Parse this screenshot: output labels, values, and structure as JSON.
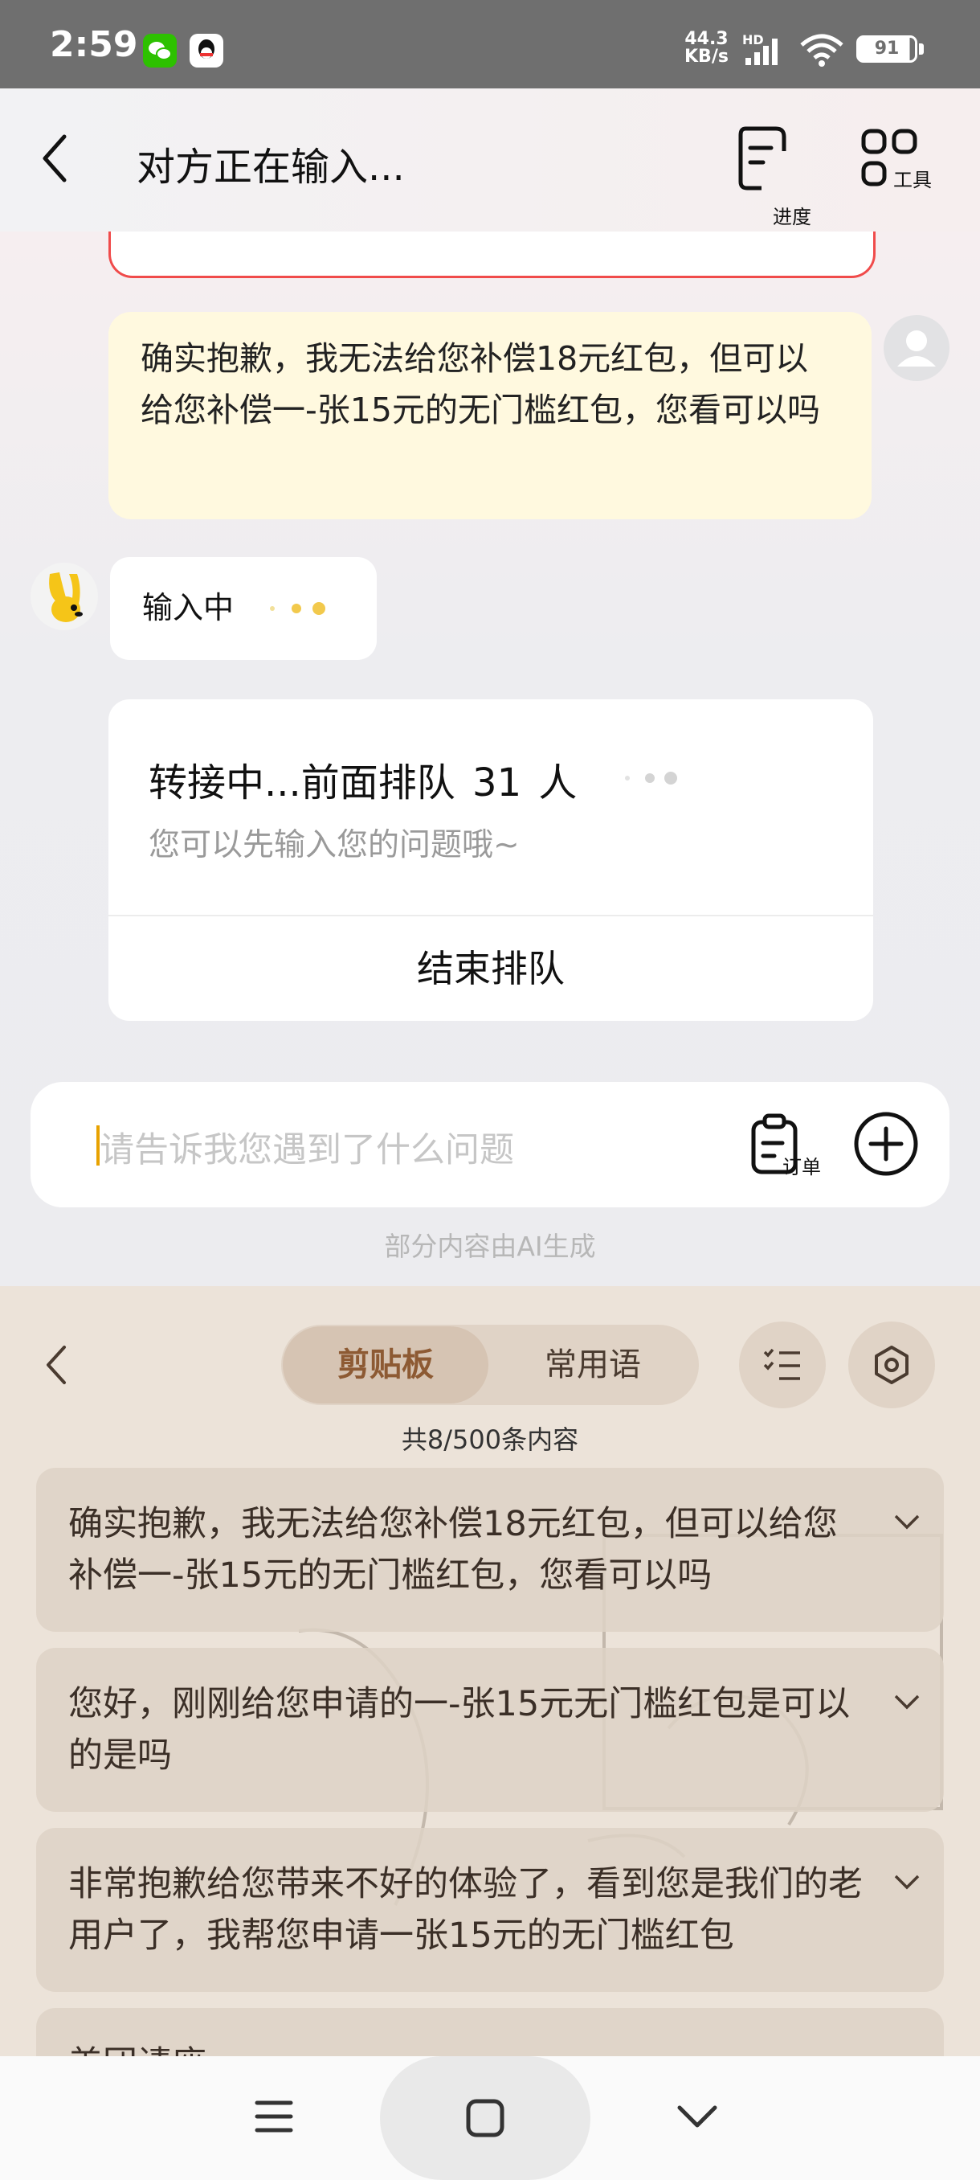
{
  "status_bar": {
    "time": "2:59",
    "net_speed_value": "44.3",
    "net_speed_unit": "KB/s",
    "net_type": "HD",
    "battery": "91"
  },
  "header": {
    "title": "对方正在输入...",
    "progress_label": "进度",
    "tools_label": "工具"
  },
  "chat": {
    "agent_message": "确实抱歉，我无法给您补偿18元红包，但可以给您补偿一-张15元的无门槛红包，您看可以吗",
    "typing_label": "输入中",
    "queue": {
      "title": "转接中...前面排队",
      "count": "31",
      "unit": "人",
      "subtitle": "您可以先输入您的问题哦~",
      "end_button": "结束排队"
    },
    "input": {
      "placeholder": "请告诉我您遇到了什么问题",
      "order_label": "订单"
    },
    "ai_note": "部分内容由AI生成"
  },
  "clipboard_panel": {
    "tabs": [
      "剪贴板",
      "常用语"
    ],
    "active_tab": "剪贴板",
    "count_text": "共8/500条内容",
    "items": [
      "确实抱歉，我无法给您补偿18元红包，但可以给您补偿一-张15元的无门槛红包，您看可以吗",
      "您好，刚刚给您申请的一-张15元无门槛红包是可以的是吗",
      "非常抱歉给您带来不好的体验了，看到您是我们的老用户了，我帮您申请一张15元的无门槛红包",
      "美团请座"
    ]
  },
  "colors": {
    "status_bar": "#6f6f6f",
    "agent_bubble": "#fff9df",
    "typing_dot": "#f2c94c",
    "clipboard_bg": "#ece3d9",
    "clipboard_active_text": "#8d5a33"
  }
}
